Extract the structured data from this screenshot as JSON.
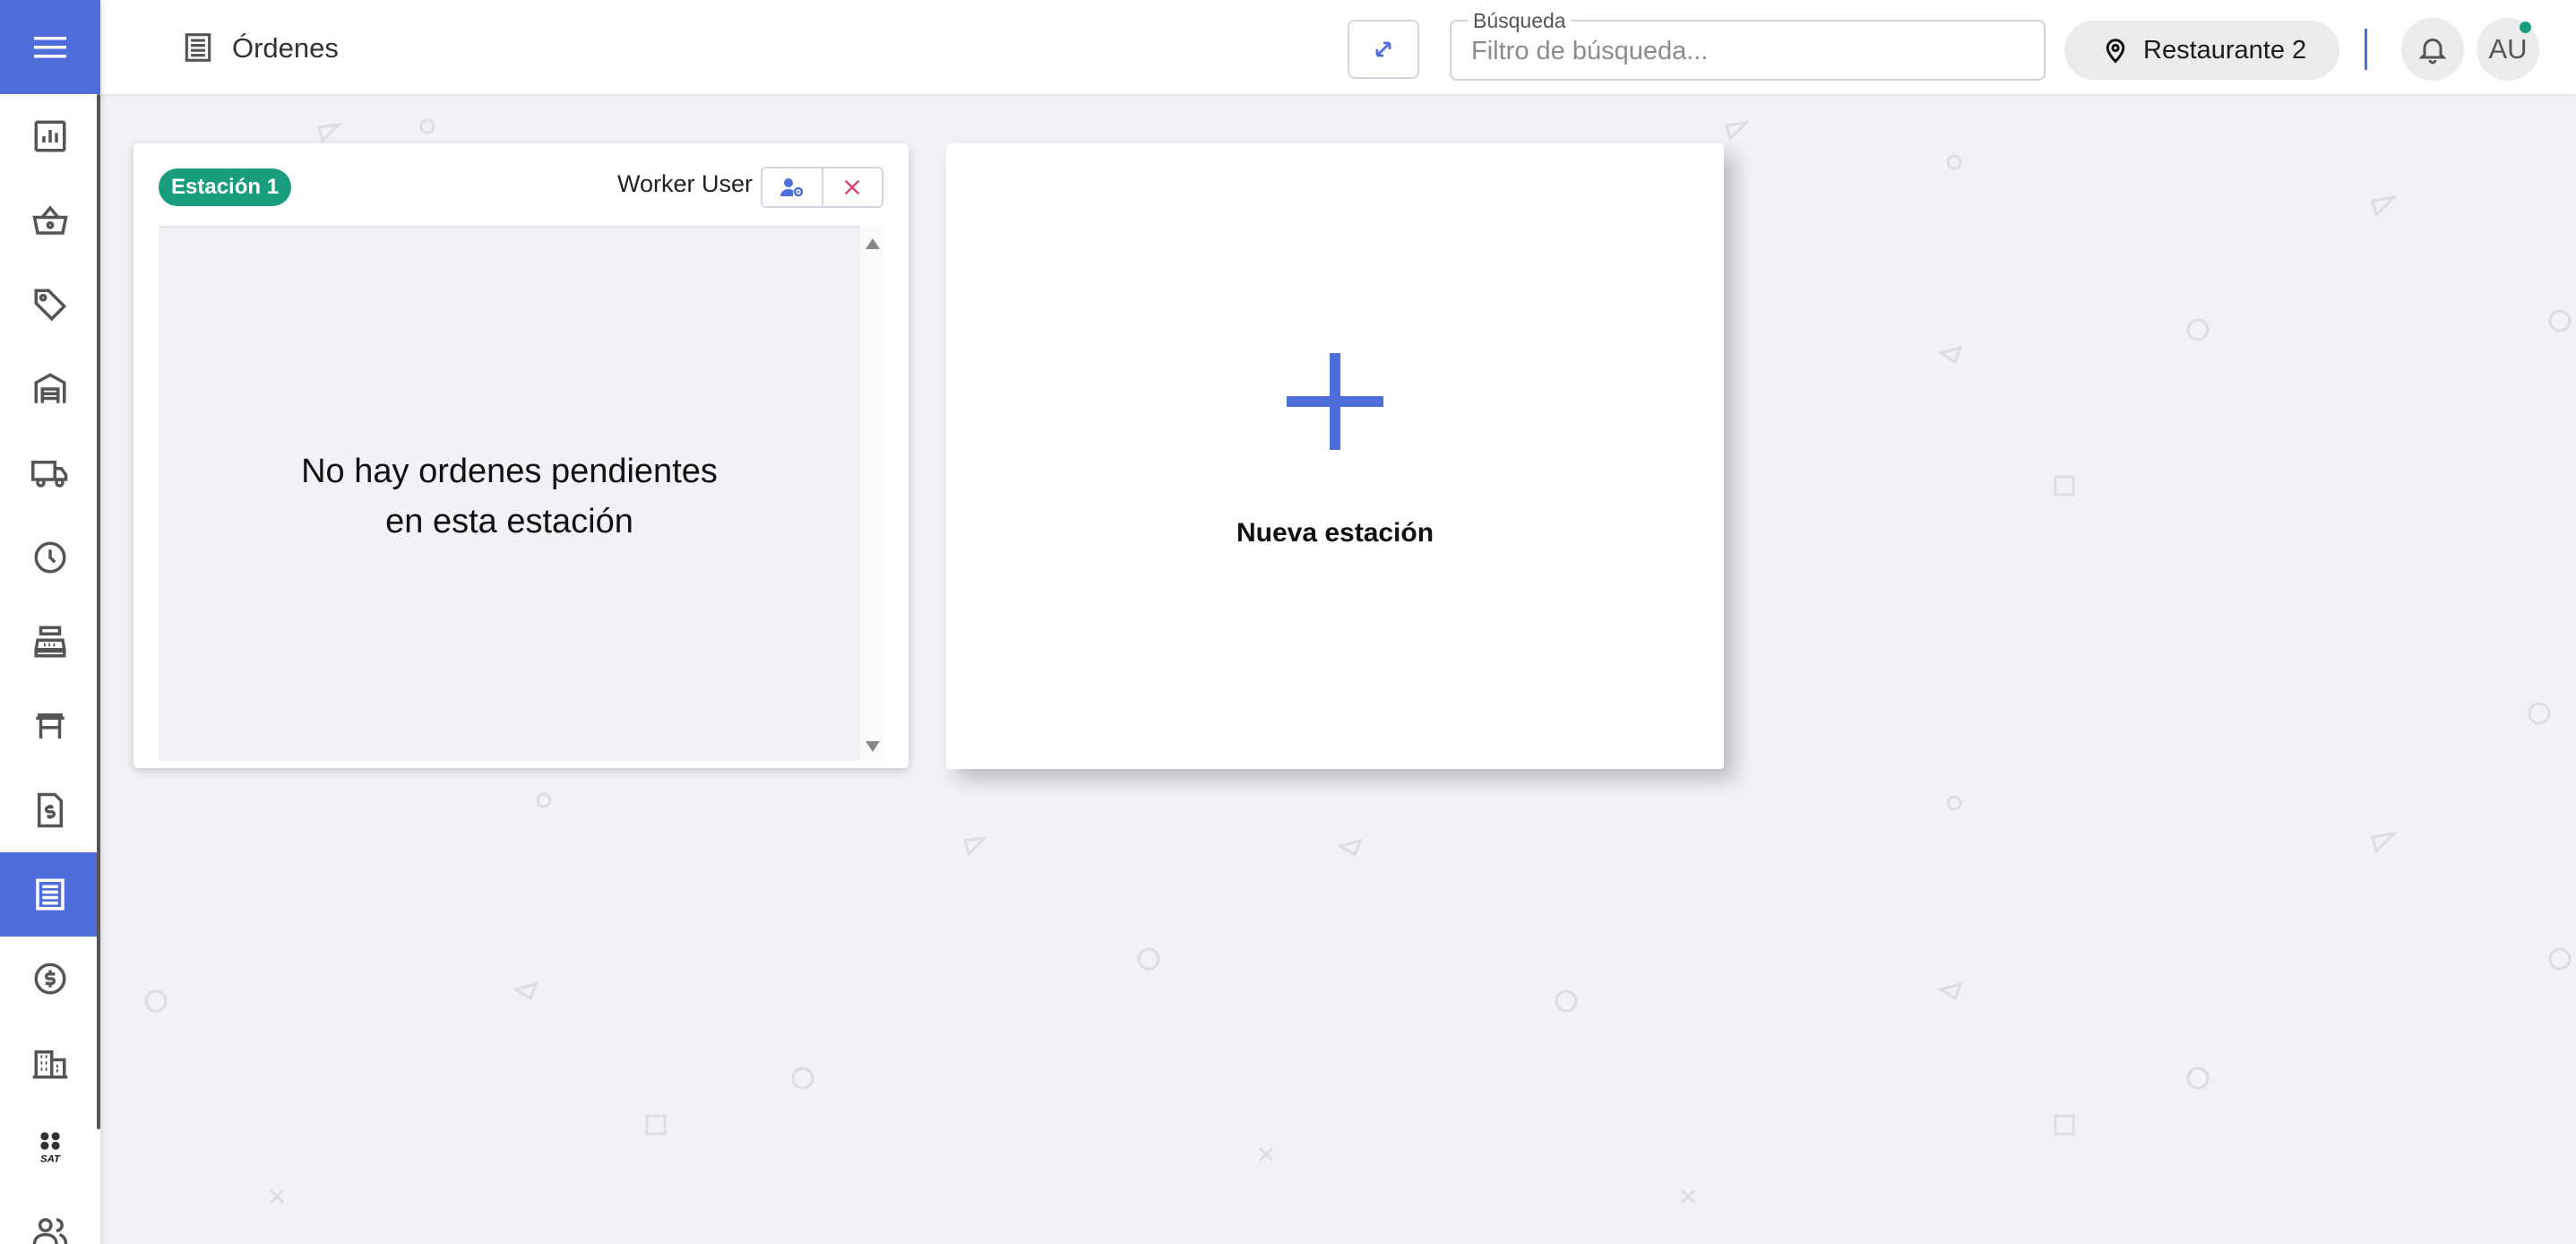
{
  "sidebar": {
    "menu_icon": "hamburger-icon",
    "items": [
      {
        "icon": "chart-icon",
        "active": false
      },
      {
        "icon": "basket-icon",
        "active": false
      },
      {
        "icon": "tag-icon",
        "active": false
      },
      {
        "icon": "warehouse-icon",
        "active": false
      },
      {
        "icon": "truck-icon",
        "active": false
      },
      {
        "icon": "clock-icon",
        "active": false
      },
      {
        "icon": "cash-register-icon",
        "active": false
      },
      {
        "icon": "table-icon",
        "active": false
      },
      {
        "icon": "invoice-icon",
        "active": false
      },
      {
        "icon": "orders-icon",
        "active": true
      },
      {
        "icon": "dollar-icon",
        "active": false
      },
      {
        "icon": "building-icon",
        "active": false
      },
      {
        "icon": "sat-icon",
        "active": false,
        "label": "SAT"
      },
      {
        "icon": "users-icon",
        "active": false
      }
    ]
  },
  "header": {
    "title": "Órdenes",
    "search": {
      "legend": "Búsqueda",
      "placeholder": "Filtro de búsqueda...",
      "value": ""
    },
    "location": "Restaurante 2",
    "avatar_initials": "AU"
  },
  "stations": [
    {
      "name": "Estación 1",
      "worker": "Worker User",
      "empty_message_line1": "No hay ordenes pendientes",
      "empty_message_line2": "en esta estación"
    }
  ],
  "new_station_label": "Nueva estación",
  "colors": {
    "accent": "#4f6ddb",
    "badge": "#1a9c7e",
    "delete": "#d6406a",
    "background": "#f1f2f6"
  }
}
